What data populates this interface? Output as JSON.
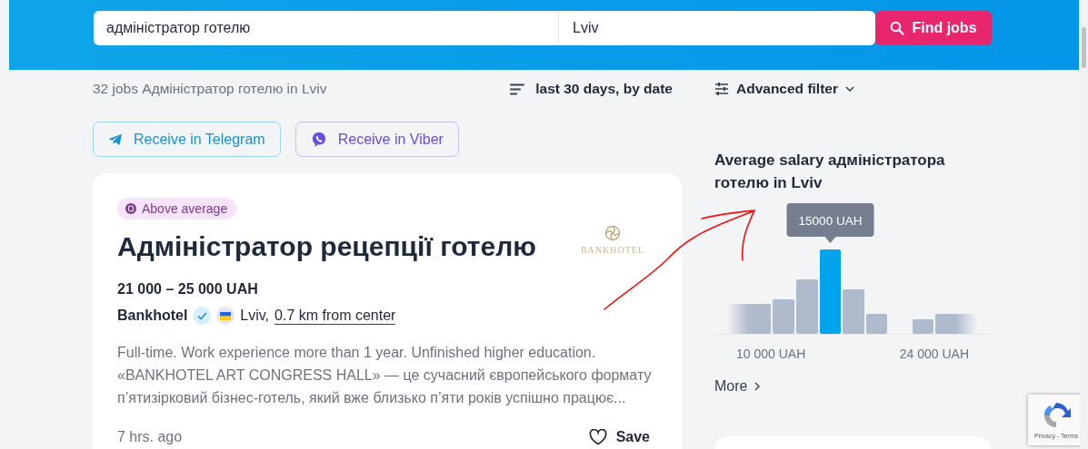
{
  "search": {
    "query_value": "адміністратор готелю",
    "location_value": "Lviv",
    "button": "Find jobs"
  },
  "results": {
    "summary": "32 jobs Адміністратор готелю in Lviv",
    "sort": "last 30 days, by date",
    "filter": "Advanced filter"
  },
  "subscribe_buttons": [
    {
      "kind": "telegram",
      "label": "Receive in Telegram"
    },
    {
      "kind": "viber",
      "label": "Receive in Viber"
    }
  ],
  "job": {
    "badge": "Above average",
    "title": "Адміністратор рецепції готелю",
    "logo_text": "BANKHOTEL",
    "salary": "21 000 – 25 000 UAH",
    "company": "Bankhotel",
    "verified": true,
    "location": "Lviv,",
    "distance": "0.7 km from center",
    "description_lines": [
      "Full-time. Work experience more than 1 year. Unfinished higher education.",
      "«BANKHOTEL ART CONGRESS HALL» — це сучасний європейського формату",
      "п’ятизірковий бізнес-готель, який вже близько п’яти років успішно працює..."
    ],
    "posted": "7 hrs. ago",
    "save": "Save",
    "saved": false
  },
  "salary_panel": {
    "title": "Average salary адміністратора готелю in Lviv",
    "tooltip": "15000 UAH",
    "bars": [
      {
        "selected": false
      },
      {
        "selected": false
      },
      {
        "selected": false
      },
      {
        "selected": true
      },
      {
        "selected": false
      },
      {
        "selected": false
      },
      {
        "selected": false
      },
      {
        "selected": false
      }
    ],
    "axis_labels": [
      "10 000 UAH",
      "24 000 UAH"
    ],
    "more": "More"
  },
  "recaptcha": {
    "links": "Privacy - Terms"
  }
}
